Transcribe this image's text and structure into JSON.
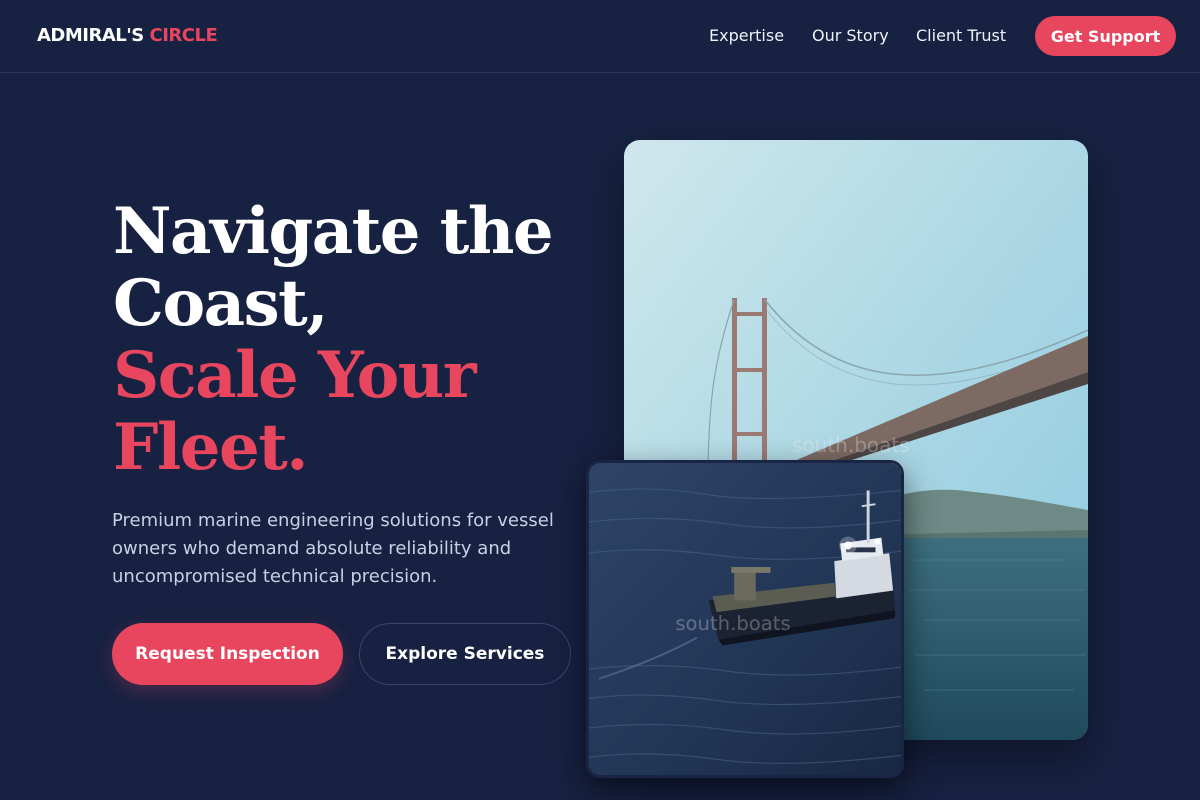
{
  "header": {
    "logo_part1": "ADMIRAL'S",
    "logo_part2": "CIRCLE",
    "nav": [
      "Expertise",
      "Our Story",
      "Client Trust"
    ],
    "cta": "Get Support"
  },
  "hero": {
    "headline_line1": "Navigate the",
    "headline_line2": "Coast,",
    "headline_accent_line1": "Scale Your",
    "headline_accent_line2": "Fleet.",
    "subtext": "Premium marine engineering solutions for vessel owners who demand absolute reliability and uncompromised technical precision.",
    "primary_button": "Request Inspection",
    "secondary_button": "Explore Services"
  },
  "images": {
    "bridge_watermark": "south.boats",
    "boat_watermark": "south.boats"
  },
  "colors": {
    "background": "#172141",
    "accent": "#e8455f",
    "text": "#ffffff",
    "muted_text": "#c8d0e3"
  }
}
